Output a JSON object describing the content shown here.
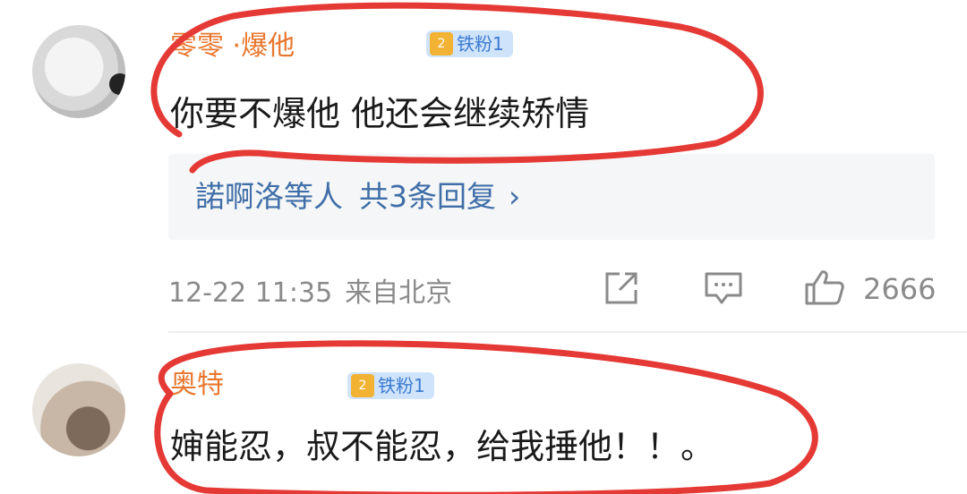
{
  "comments": [
    {
      "username": "零零 ·爆他",
      "badge": "铁粉1",
      "badge_icon": "2",
      "text": "你要不爆他 他还会继续矫情",
      "replies": {
        "names": "諾啊洛等人",
        "count": "共3条回复",
        "chevron": "›"
      },
      "timestamp": "12-22 11:35",
      "location": "来自北京",
      "likes": "2666"
    },
    {
      "username": "奥特",
      "badge": "铁粉1",
      "badge_icon": "2",
      "text": "婶能忍，叔不能忍，给我捶他！！。"
    }
  ],
  "colors": {
    "username": "#e8772e",
    "badge_bg": "#cfe3fb",
    "badge_text": "#3b7bd1",
    "link": "#3f6ea8",
    "meta": "#8a8a8a",
    "annotation": "#e53935"
  }
}
